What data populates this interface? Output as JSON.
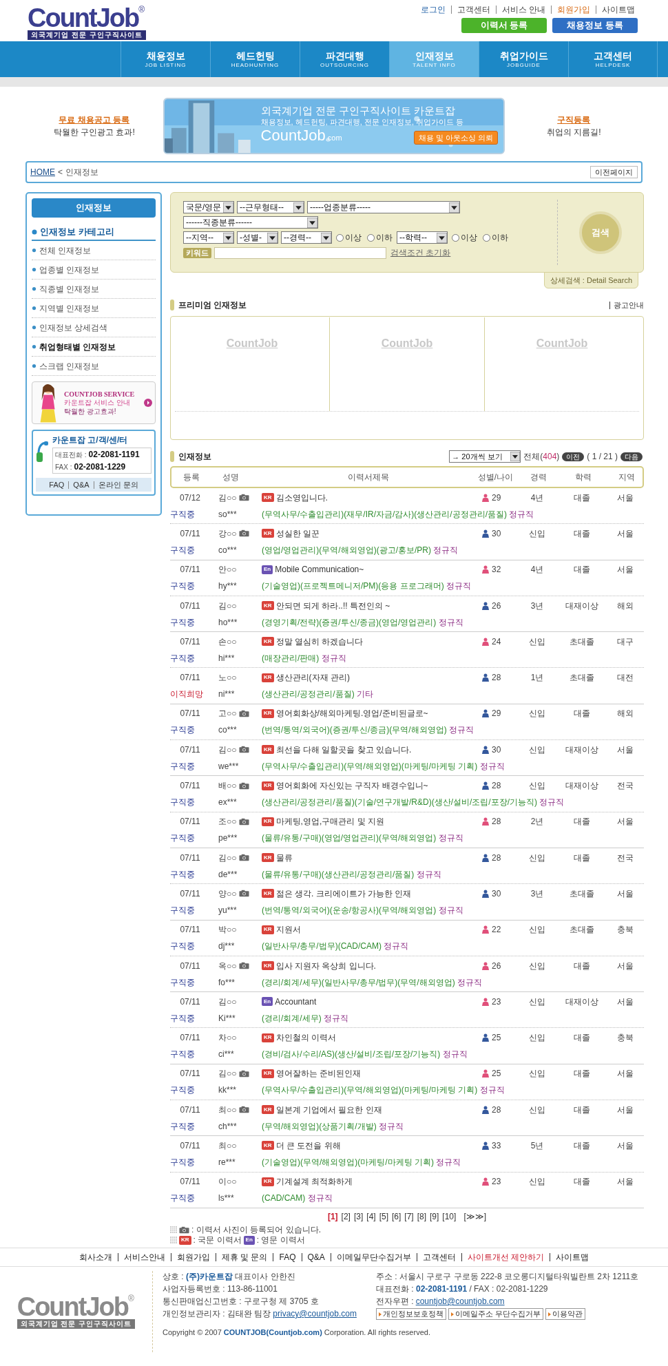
{
  "header": {
    "logo": {
      "name": "CountJob",
      "mark": "®",
      "tagline": "외국계기업 전문 구인구직사이트"
    },
    "top_links": [
      {
        "label": "로그인",
        "kind": "login"
      },
      {
        "label": "고객센터",
        "kind": "plain"
      },
      {
        "label": "서비스 안내",
        "kind": "plain"
      },
      {
        "label": "회원가입",
        "kind": "join"
      },
      {
        "label": "사이트맵",
        "kind": "plain"
      }
    ],
    "buttons": [
      {
        "label": "이력서 등록",
        "kind": "green"
      },
      {
        "label": "채용정보 등록",
        "kind": "blue"
      }
    ]
  },
  "nav": [
    {
      "label": "채용정보",
      "sub": "JOB LISTING",
      "selected": false
    },
    {
      "label": "헤드헌팅",
      "sub": "HEADHUNTING",
      "selected": false
    },
    {
      "label": "파견대행",
      "sub": "OUTSOURCING",
      "selected": false
    },
    {
      "label": "인재정보",
      "sub": "TALENT INFO",
      "selected": true
    },
    {
      "label": "취업가이드",
      "sub": "JOBGUIDE",
      "selected": false
    },
    {
      "label": "고객센터",
      "sub": "HELPDESK",
      "selected": false
    }
  ],
  "promo": {
    "left": {
      "title": "무료 채용공고 등록",
      "subtitle": "탁월한 구인광고 효과!"
    },
    "banner": {
      "headline": "외국계기업 전문 구인구직사이트 카운트잡",
      "subline": "채용정보, 헤드헌팅, 파견대행, 전문 인재정보, 취업가이드 등",
      "brand": "CountJob",
      "brand_suffix": ".com",
      "button": "채용 및 아웃소싱 의뢰"
    },
    "right": {
      "title": "구직등록",
      "subtitle": "취업의 지름길!"
    }
  },
  "breadcrumb": {
    "home": "HOME",
    "separator": "<",
    "current": "인재정보",
    "back_button": "이전페이지"
  },
  "sidebar": {
    "title": "인재정보",
    "category_heading": "인재정보 카테고리",
    "items": [
      {
        "label": "전체 인재정보",
        "selected": false
      },
      {
        "label": "업종별 인재정보",
        "selected": false
      },
      {
        "label": "직종별 인재정보",
        "selected": false
      },
      {
        "label": "지역별 인재정보",
        "selected": false
      },
      {
        "label": "인재정보 상세검색",
        "selected": false
      },
      {
        "label": "취업형태별 인재정보",
        "selected": true
      },
      {
        "label": "스크랩 인재정보",
        "selected": false
      }
    ],
    "ad": {
      "title": "COUNTJOB SERVICE",
      "subtitle": "카운트잡 서비스 안내",
      "tagline": "탁월한 광고효과!"
    },
    "support": {
      "title": "카운트잡 고/객/센/터",
      "phone_label": "대표전화 :",
      "phone": "02-2081-1191",
      "fax_label": "FAX :",
      "fax": "02-2081-1229",
      "links": [
        "FAQ",
        "Q&A",
        "온라인 문의"
      ]
    }
  },
  "search": {
    "lines": [
      {
        "fields": [
          {
            "kind": "select",
            "text": "국문/영문"
          },
          {
            "kind": "select",
            "text": "--근무형태--"
          },
          {
            "kind": "select",
            "text": "-----업종분류-----"
          }
        ]
      },
      {
        "fields": [
          {
            "kind": "select",
            "text": "------직종분류------"
          }
        ]
      },
      {
        "fields": [
          {
            "kind": "select",
            "text": "--지역--"
          },
          {
            "kind": "select",
            "text": "-성별-"
          },
          {
            "kind": "select",
            "text": "--경력--"
          },
          {
            "kind": "radio",
            "text": "이상",
            "selected": false
          },
          {
            "kind": "radio",
            "text": "이하",
            "selected": false
          },
          {
            "kind": "select",
            "text": "--학력--"
          },
          {
            "kind": "radio",
            "text": "이상",
            "selected": false
          },
          {
            "kind": "radio",
            "text": "이하",
            "selected": false
          }
        ]
      },
      {
        "fields": [
          {
            "kind": "label",
            "text": "키워드"
          },
          {
            "kind": "input"
          },
          {
            "kind": "link",
            "text": "검색조건 초기화"
          }
        ]
      }
    ],
    "button": "검색",
    "detail_tab": "상세검색 : Detail Search"
  },
  "premium": {
    "title": "프리미엄 인재정보",
    "ad_link": "광고안내",
    "slots": [
      "CountJob",
      "CountJob",
      "CountJob"
    ]
  },
  "talent": {
    "title": "인재정보",
    "page_size": "→ 20개씩 보기",
    "total": "전체(**404**)",
    "prev": "이전",
    "page_info": "( 1 / 21 )",
    "next": "다음",
    "columns": [
      "등록",
      "성명",
      "이력서제목",
      "성별/나이",
      "경력",
      "학력",
      "지역"
    ],
    "rows": [
      {
        "date": "07/12",
        "name": "김○○",
        "photo": true,
        "english": false,
        "badge": "KR",
        "title": "김소영입니다.",
        "female": true,
        "age": "29",
        "career": "4년",
        "education": "대졸",
        "region": "서울",
        "status": "구직중",
        "job_change": false,
        "user": "so***",
        "categories": "(무역사무/수출입관리)(재무/IR/자금/감사)(생산관리/공정관리/품질) **정규직**"
      },
      {
        "date": "07/11",
        "name": "강○○",
        "photo": true,
        "english": false,
        "badge": "KR",
        "title": "성실한 일꾼",
        "female": false,
        "age": "30",
        "career": "신입",
        "education": "대졸",
        "region": "서울",
        "status": "구직중",
        "job_change": false,
        "user": "co***",
        "categories": "(영업/영업관리)(무역/해외영업)(광고/홍보/PR) **정규직**"
      },
      {
        "date": "07/11",
        "name": "안○○",
        "photo": false,
        "english": true,
        "badge": "En",
        "title": "Mobile Communication~",
        "female": true,
        "age": "32",
        "career": "4년",
        "education": "대졸",
        "region": "서울",
        "status": "구직중",
        "job_change": false,
        "user": "hy***",
        "categories": "(기술영업)(프로젝트메니저/PM)(응용 프로그래머) **정규직**"
      },
      {
        "date": "07/11",
        "name": "김○○",
        "photo": false,
        "english": false,
        "badge": "KR",
        "title": "안되면 되게 하라..!! 특전인의 ~",
        "female": false,
        "age": "26",
        "career": "3년",
        "education": "대재이상",
        "region": "해외",
        "status": "구직중",
        "job_change": false,
        "user": "ho***",
        "categories": "(경영기획/전략)(증권/투신/종금)(영업/영업관리) **정규직**"
      },
      {
        "date": "07/11",
        "name": "손○○",
        "photo": false,
        "english": false,
        "badge": "KR",
        "title": "정말 열심히 하겠습니다",
        "female": true,
        "age": "24",
        "career": "신입",
        "education": "초대졸",
        "region": "대구",
        "status": "구직중",
        "job_change": false,
        "user": "hi***",
        "categories": "(매장관리/판매) **정규직**"
      },
      {
        "date": "07/11",
        "name": "노○○",
        "photo": false,
        "english": false,
        "badge": "KR",
        "title": "생산관리(자재 관리)",
        "female": false,
        "age": "28",
        "career": "1년",
        "education": "초대졸",
        "region": "대전",
        "status": "이직희망",
        "job_change": true,
        "user": "ni***",
        "categories": "(생산관리/공정관리/품질) **기타**"
      },
      {
        "date": "07/11",
        "name": "고○○",
        "photo": true,
        "english": false,
        "badge": "KR",
        "title": "영어회화상/해외마케팅.영업/준비된글로~",
        "female": false,
        "age": "29",
        "career": "신입",
        "education": "대졸",
        "region": "해외",
        "status": "구직중",
        "job_change": false,
        "user": "co***",
        "categories": "(번역/통역/외국어)(증권/투신/종금)(무역/해외영업) **정규직**"
      },
      {
        "date": "07/11",
        "name": "김○○",
        "photo": true,
        "english": false,
        "badge": "KR",
        "title": "최선을 다해 일할곳을 찾고 있습니다.",
        "female": false,
        "age": "30",
        "career": "신입",
        "education": "대재이상",
        "region": "서울",
        "status": "구직중",
        "job_change": false,
        "user": "we***",
        "categories": "(무역사무/수출입관리)(무역/해외영업)(마케팅/마케팅 기획) **정규직**"
      },
      {
        "date": "07/11",
        "name": "배○○",
        "photo": true,
        "english": false,
        "badge": "KR",
        "title": "영어회화에 자신있는 구직자 배경수입니~",
        "female": false,
        "age": "28",
        "career": "신입",
        "education": "대재이상",
        "region": "전국",
        "status": "구직중",
        "job_change": false,
        "user": "ex***",
        "categories": "(생산관리/공정관리/품질)(기술/연구개발/R&D)(생산/설비/조립/포장/기능직) **정규직**"
      },
      {
        "date": "07/11",
        "name": "조○○",
        "photo": true,
        "english": false,
        "badge": "KR",
        "title": "마케팅,영업,구매관리 및 지원",
        "female": true,
        "age": "28",
        "career": "2년",
        "education": "대졸",
        "region": "서울",
        "status": "구직중",
        "job_change": false,
        "user": "pe***",
        "categories": "(물류/유통/구매)(영업/영업관리)(무역/해외영업) **정규직**"
      },
      {
        "date": "07/11",
        "name": "김○○",
        "photo": true,
        "english": false,
        "badge": "KR",
        "title": "물류",
        "female": false,
        "age": "28",
        "career": "신입",
        "education": "대졸",
        "region": "전국",
        "status": "구직중",
        "job_change": false,
        "user": "de***",
        "categories": "(물류/유통/구매)(생산관리/공정관리/품질) **정규직**"
      },
      {
        "date": "07/11",
        "name": "양○○",
        "photo": true,
        "english": false,
        "badge": "KR",
        "title": "젊은 생각. 크리에이트가 가능한 인재",
        "female": false,
        "age": "30",
        "career": "3년",
        "education": "초대졸",
        "region": "서울",
        "status": "구직중",
        "job_change": false,
        "user": "yu***",
        "categories": "(번역/통역/외국어)(운송/항공사)(무역/해외영업) **정규직**"
      },
      {
        "date": "07/11",
        "name": "박○○",
        "photo": false,
        "english": false,
        "badge": "KR",
        "title": "지원서",
        "female": true,
        "age": "22",
        "career": "신입",
        "education": "초대졸",
        "region": "충북",
        "status": "구직중",
        "job_change": false,
        "user": "dj***",
        "categories": "(일반사무/총무/법무)(CAD/CAM) **정규직**"
      },
      {
        "date": "07/11",
        "name": "옥○○",
        "photo": true,
        "english": false,
        "badge": "KR",
        "title": "입사 지원자 옥상희 입니다.",
        "female": true,
        "age": "26",
        "career": "신입",
        "education": "대졸",
        "region": "서울",
        "status": "구직중",
        "job_change": false,
        "user": "fo***",
        "categories": "(경리/회계/세무)(일반사무/총무/법무)(무역/해외영업) **정규직**"
      },
      {
        "date": "07/11",
        "name": "김○○",
        "photo": false,
        "english": true,
        "badge": "En",
        "title": "Accountant",
        "female": true,
        "age": "23",
        "career": "신입",
        "education": "대재이상",
        "region": "서울",
        "status": "구직중",
        "job_change": false,
        "user": "Ki***",
        "categories": "(경리/회계/세무) **정규직**"
      },
      {
        "date": "07/11",
        "name": "차○○",
        "photo": false,
        "english": false,
        "badge": "KR",
        "title": "차인철의 이력서",
        "female": false,
        "age": "25",
        "career": "신입",
        "education": "대졸",
        "region": "충북",
        "status": "구직중",
        "job_change": false,
        "user": "ci***",
        "categories": "(경비/검사/수리/AS)(생산/설비/조립/포장/기능직) **정규직**"
      },
      {
        "date": "07/11",
        "name": "김○○",
        "photo": true,
        "english": false,
        "badge": "KR",
        "title": "영어잘하는 준비된인재",
        "female": true,
        "age": "25",
        "career": "신입",
        "education": "대졸",
        "region": "서울",
        "status": "구직중",
        "job_change": false,
        "user": "kk***",
        "categories": "(무역사무/수출입관리)(무역/해외영업)(마케팅/마케팅 기획) **정규직**"
      },
      {
        "date": "07/11",
        "name": "최○○",
        "photo": true,
        "english": false,
        "badge": "KR",
        "title": "일본계 기업에서 필요한 인재",
        "female": false,
        "age": "28",
        "career": "신입",
        "education": "대졸",
        "region": "서울",
        "status": "구직중",
        "job_change": false,
        "user": "ch***",
        "categories": "(무역/해외영업)(상품기획/개발) **정규직**"
      },
      {
        "date": "07/11",
        "name": "최○○",
        "photo": false,
        "english": false,
        "badge": "KR",
        "title": "더 큰 도전을 위해",
        "female": false,
        "age": "33",
        "career": "5년",
        "education": "대졸",
        "region": "서울",
        "status": "구직중",
        "job_change": false,
        "user": "re***",
        "categories": "(기술영업)(무역/해외영업)(마케팅/마케팅 기획) **정규직**"
      },
      {
        "date": "07/11",
        "name": "이○○",
        "photo": false,
        "english": false,
        "badge": "KR",
        "title": "기계설계 최적화하게",
        "female": true,
        "age": "23",
        "career": "신입",
        "education": "대졸",
        "region": "서울",
        "status": "구직중",
        "job_change": false,
        "user": "ls***",
        "categories": "(CAD/CAM) **정규직**"
      }
    ],
    "pages": [
      {
        "label": "[1]",
        "selected": true
      },
      {
        "label": "[2]",
        "selected": false
      },
      {
        "label": "[3]",
        "selected": false
      },
      {
        "label": "[4]",
        "selected": false
      },
      {
        "label": "[5]",
        "selected": false
      },
      {
        "label": "[6]",
        "selected": false
      },
      {
        "label": "[7]",
        "selected": false
      },
      {
        "label": "[8]",
        "selected": false
      },
      {
        "label": "[9]",
        "selected": false
      },
      {
        "label": "[10]",
        "selected": false
      },
      {
        "label": "[≫≫]",
        "selected": false
      }
    ],
    "legend": {
      "photo_text": ": 이력서 사진이 등록되어 있습니다.",
      "kr_badge": "KR",
      "kr_text": ": 국문 이력서",
      "en_badge": "En",
      "en_text": ": 영문 이력서"
    }
  },
  "footer": {
    "links": [
      {
        "label": "회사소개",
        "kind": "plain"
      },
      {
        "label": "서비스안내",
        "kind": "plain"
      },
      {
        "label": "회원가입",
        "kind": "plain"
      },
      {
        "label": "제휴 및 문의",
        "kind": "plain"
      },
      {
        "label": "FAQ",
        "kind": "plain"
      },
      {
        "label": "Q&A",
        "kind": "plain"
      },
      {
        "label": "이메일무단수집거부",
        "kind": "plain"
      },
      {
        "label": "고객센터",
        "kind": "plain"
      },
      {
        "label": "사이트개선 제안하기",
        "kind": "highlight"
      },
      {
        "label": "사이트맵",
        "kind": "plain"
      }
    ],
    "logo": {
      "name": "CountJob",
      "mark": "®",
      "tagline": "외국계기업 전문 구인구직사이트"
    },
    "info_left": [
      "상호 : **(주)카운트잡** 대표이사 안한진",
      "사업자등록번호 : 113-86-11001",
      "통신판매업신고번호 : 구로구청 제 3705 호"
    ],
    "manager": "개인정보관리자 : 김태완 팀장",
    "manager_email": "privacy@countjob.com",
    "info_right": [
      "주소 : 서울시 구로구 구로동 222-8 코오롱디지털타워빌란트 2차 1211호",
      "대표전화 : **02-2081-1191** / FAX : 02-2081-1229"
    ],
    "email_label": "전자우편 :",
    "email": "countjob@countjob.com",
    "policy_buttons": [
      "개인정보보호정책",
      "이메일주소 무단수집거부",
      "이용약관"
    ],
    "copyright": "Copyright © 2007 **COUNTJOB(Countjob.com)** Corporation. All rights reserved."
  }
}
